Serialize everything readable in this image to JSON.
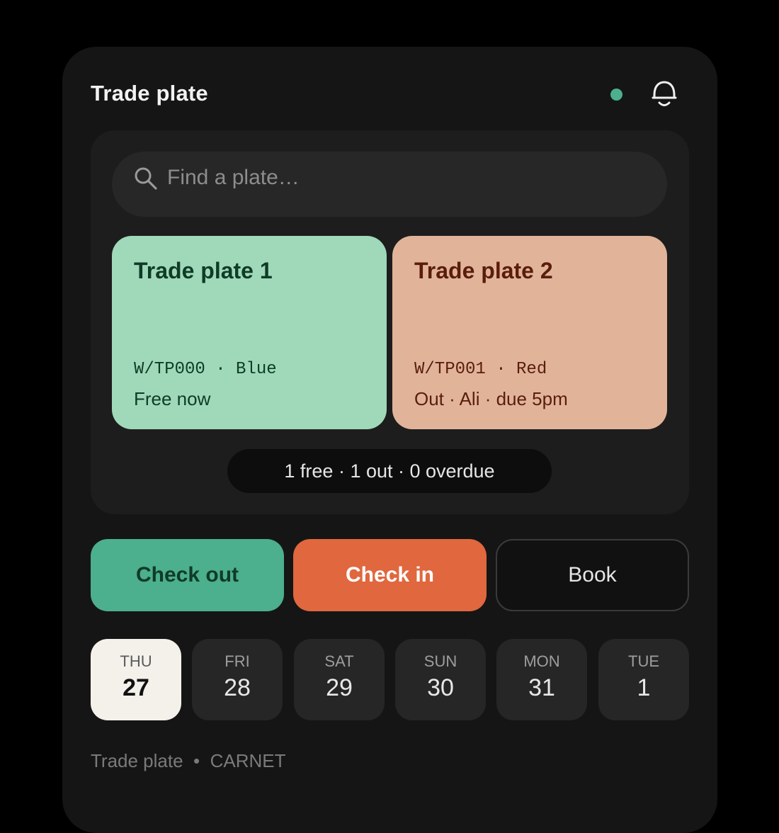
{
  "app": {
    "title": "Trade plate",
    "status_color": "#4caf8e"
  },
  "search": {
    "placeholder": "Find a plate…"
  },
  "plates": [
    {
      "name": "Trade plate 1",
      "reg_line": "W/TP000 · Blue",
      "status": "Free now",
      "bg_color": "#9fd9b9",
      "text_color": "#0f3b27"
    },
    {
      "name": "Trade plate 2",
      "reg_line": "W/TP001 · Red",
      "status": "Out · Ali · due 5pm",
      "bg_color": "#e1b49a",
      "text_color": "#5a1d0c"
    }
  ],
  "summary": "1 free · 1 out · 0 overdue",
  "actions": {
    "check_out": "Check out",
    "check_out_color": "#4caf8e",
    "check_in": "Check in",
    "check_in_color": "#e0673e",
    "book": "Book"
  },
  "days": [
    {
      "name": "THU",
      "num": "27",
      "selected": true
    },
    {
      "name": "FRI",
      "num": "28",
      "selected": false
    },
    {
      "name": "SAT",
      "num": "29",
      "selected": false
    },
    {
      "name": "SUN",
      "num": "30",
      "selected": false
    },
    {
      "name": "MON",
      "num": "31",
      "selected": false
    },
    {
      "name": "TUE",
      "num": "1",
      "selected": false
    }
  ],
  "footer": {
    "app_name": "Trade plate",
    "separator": "•",
    "mode": "CARNET"
  },
  "icons": {
    "search": "search-icon",
    "bell": "bell-icon"
  }
}
